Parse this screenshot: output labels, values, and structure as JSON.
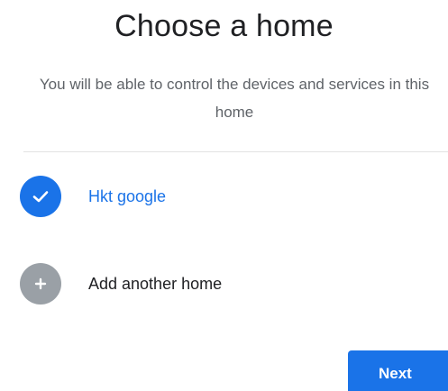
{
  "header": {
    "title": "Choose a home",
    "subtitle": "You will be able to control the devices and services in this home"
  },
  "homes": [
    {
      "label": "Hkt google",
      "selected": true,
      "icon": "check-icon"
    },
    {
      "label": "Add another home",
      "selected": false,
      "icon": "plus-icon"
    }
  ],
  "actions": {
    "next_label": "Next"
  },
  "colors": {
    "accent": "#1a73e8",
    "add_circle": "#9aa0a6"
  }
}
